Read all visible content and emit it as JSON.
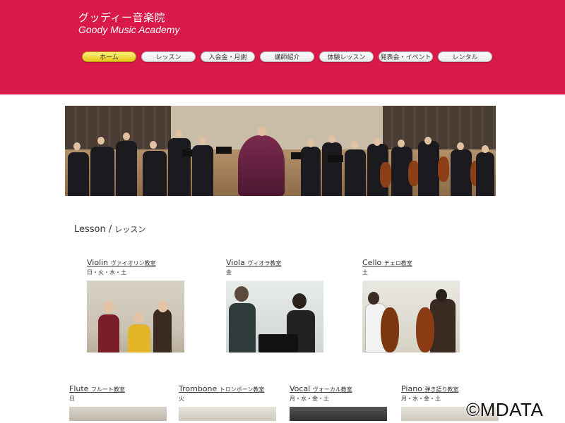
{
  "header": {
    "brand_jp": "グッディー音楽院",
    "brand_en": "Goody Music Academy",
    "background_color": "#d8194a"
  },
  "nav": {
    "items": [
      {
        "label": "ホーム",
        "active": true
      },
      {
        "label": "レッスン",
        "active": false
      },
      {
        "label": "入会金・月謝",
        "active": false
      },
      {
        "label": "講師紹介",
        "active": false
      },
      {
        "label": "体験レッスン",
        "active": false
      },
      {
        "label": "発表会・イベント",
        "active": false
      },
      {
        "label": "レンタル",
        "active": false
      }
    ],
    "active_color": "#f2d02e"
  },
  "section": {
    "title_en": "Lesson /",
    "title_jp": "レッスン"
  },
  "lessons": [
    {
      "name_en": "Violin",
      "name_jp": "ヴァイオリン教室",
      "days": "日・火・水・土"
    },
    {
      "name_en": "Viola",
      "name_jp": "ヴィオラ教室",
      "days": "金"
    },
    {
      "name_en": "Cello",
      "name_jp": "チェロ教室",
      "days": "土"
    },
    {
      "name_en": "Flute",
      "name_jp": "フルート教室",
      "days": "日"
    },
    {
      "name_en": "Trombone",
      "name_jp": "トロンボーン教室",
      "days": "火"
    },
    {
      "name_en": "Vocal",
      "name_jp": "ヴォーカル教室",
      "days": "月・水・金・土"
    },
    {
      "name_en": "Piano",
      "name_jp": "弾き語り教室",
      "days": "月・水・金・土"
    }
  ],
  "watermark": "©MDATA"
}
